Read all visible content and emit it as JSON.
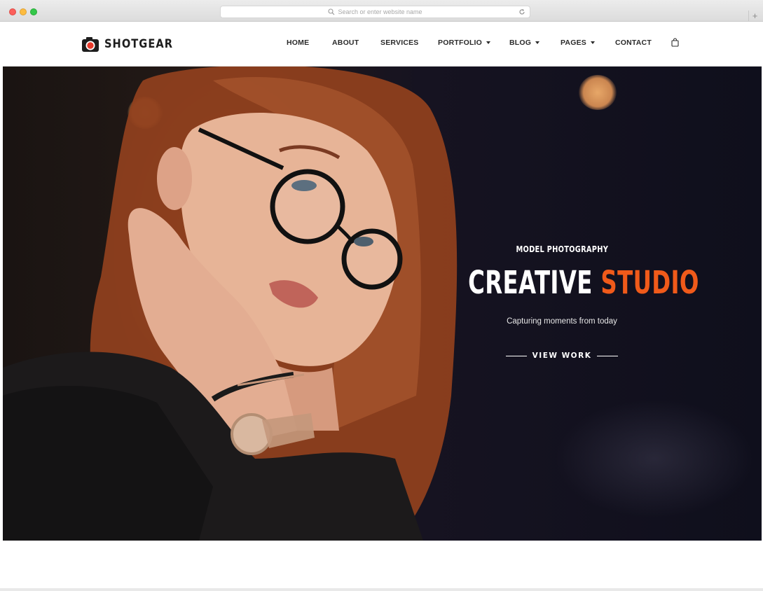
{
  "browser": {
    "url_placeholder": "Search or enter website name",
    "new_tab_label": "+"
  },
  "brand": {
    "name": "SHOTGEAR",
    "accent_color": "#f05a1a",
    "logo_icon": "camera-icon"
  },
  "nav": {
    "items": [
      {
        "label": "HOME",
        "dropdown": false
      },
      {
        "label": "ABOUT",
        "dropdown": false
      },
      {
        "label": "SERVICES",
        "dropdown": false
      },
      {
        "label": "PORTFOLIO",
        "dropdown": true
      },
      {
        "label": "BLOG",
        "dropdown": true
      },
      {
        "label": "PAGES",
        "dropdown": true
      },
      {
        "label": "CONTACT",
        "dropdown": false
      }
    ],
    "cart_icon": "shopping-bag-icon"
  },
  "hero": {
    "eyebrow": "MODEL PHOTOGRAPHY",
    "headline_white": "CREATIVE",
    "headline_accent": "STUDIO",
    "tagline": "Capturing moments from today",
    "cta_label": "VIEW WORK"
  }
}
